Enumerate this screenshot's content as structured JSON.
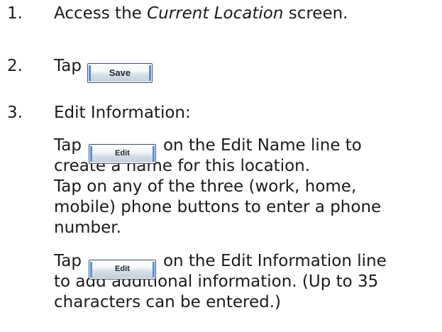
{
  "steps": [
    {
      "number": "1.",
      "text_before": "Access the ",
      "screen_name": "Current Location",
      "text_after": " screen."
    },
    {
      "number": "2.",
      "text": "Tap",
      "button_label": "Save"
    },
    {
      "number": "3.",
      "heading": "Edit Information:",
      "edit_name": {
        "tap": "Tap",
        "button_label": "Edit",
        "rest_line1": "on the Edit Name line to",
        "line2": "create a name for this location."
      },
      "phone": {
        "line1": "Tap on any of the three (work, home,",
        "line2": "mobile) phone buttons to enter a phone",
        "line3": "number."
      },
      "edit_info": {
        "tap": "Tap",
        "button_label": "Edit",
        "rest_line1": "on the Edit Information line",
        "line2": "to add additional information.  (Up to 35",
        "line3": "characters can be entered.)"
      }
    }
  ]
}
